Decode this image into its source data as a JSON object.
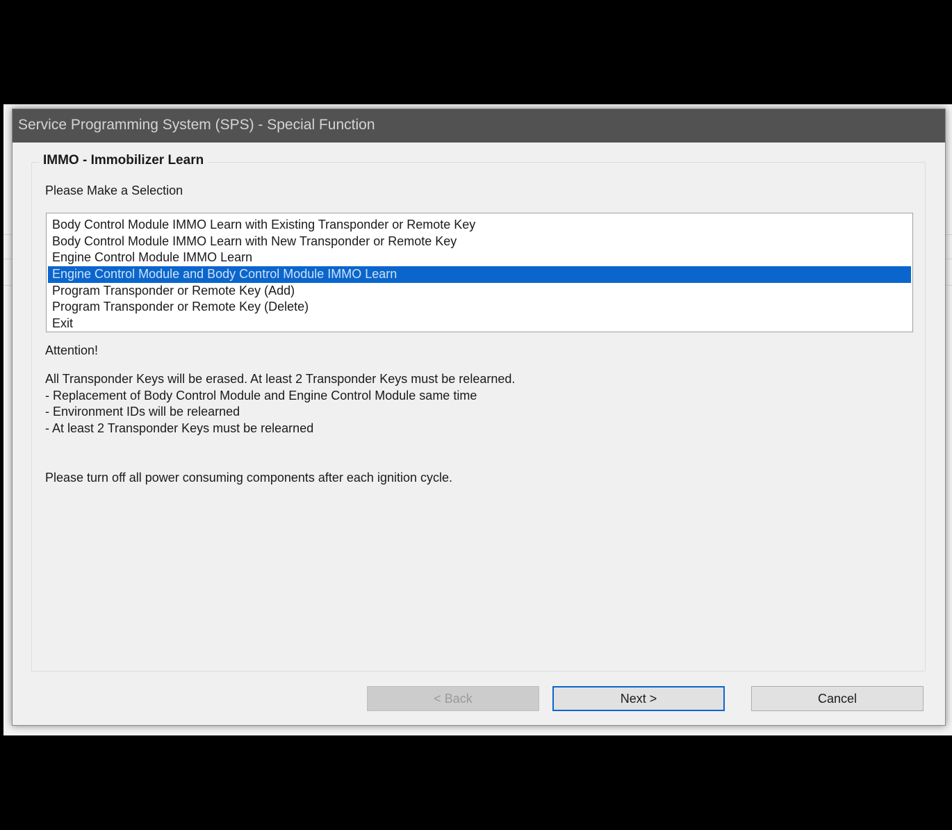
{
  "window": {
    "title": "Service Programming System (SPS) - Special Function"
  },
  "group": {
    "title": "IMMO - Immobilizer Learn"
  },
  "prompt": "Please Make a Selection",
  "options": [
    {
      "label": "Body Control Module IMMO Learn with Existing Transponder or Remote Key",
      "selected": false
    },
    {
      "label": "Body Control Module IMMO Learn with New Transponder or Remote Key",
      "selected": false
    },
    {
      "label": "Engine Control Module IMMO Learn",
      "selected": false
    },
    {
      "label": "Engine Control Module and Body Control Module IMMO Learn",
      "selected": true
    },
    {
      "label": "Program Transponder or Remote Key (Add)",
      "selected": false
    },
    {
      "label": "Program Transponder or Remote Key (Delete)",
      "selected": false
    },
    {
      "label": "Exit",
      "selected": false
    }
  ],
  "attention": {
    "title": "Attention!",
    "lines": [
      "All Transponder Keys will be erased. At least 2 Transponder Keys must be relearned.",
      "- Replacement of Body Control Module and Engine Control Module same time",
      "- Environment IDs will be relearned",
      "- At least 2 Transponder Keys must be relearned"
    ],
    "note": "Please turn off all power consuming components after each ignition cycle."
  },
  "buttons": {
    "back": "< Back",
    "next": "Next >",
    "cancel": "Cancel"
  },
  "colors": {
    "titlebar": "#525252",
    "selection": "#0a66cc",
    "dialog_bg": "#f0f0f0"
  }
}
